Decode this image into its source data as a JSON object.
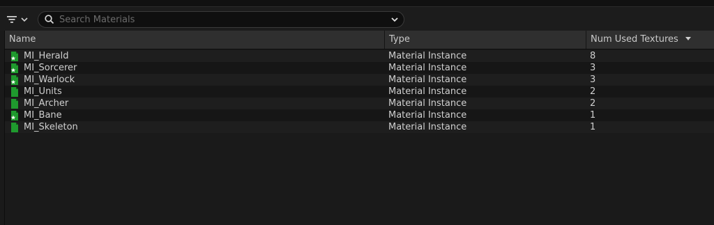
{
  "toolbar": {
    "filter_icon": "filter-icon",
    "search": {
      "placeholder": "Search Materials",
      "value": ""
    }
  },
  "table": {
    "columns": [
      {
        "label": "Name"
      },
      {
        "label": "Type"
      },
      {
        "label": "Num Used Textures",
        "sorted": "descending"
      }
    ],
    "rows": [
      {
        "name": "MI_Herald",
        "type": "Material Instance",
        "num_used_textures": "8",
        "icon": "material-instance-star-icon"
      },
      {
        "name": "MI_Sorcerer",
        "type": "Material Instance",
        "num_used_textures": "3",
        "icon": "material-instance-star-icon"
      },
      {
        "name": "MI_Warlock",
        "type": "Material Instance",
        "num_used_textures": "3",
        "icon": "material-instance-star-icon"
      },
      {
        "name": "MI_Units",
        "type": "Material Instance",
        "num_used_textures": "2",
        "icon": "material-instance-icon"
      },
      {
        "name": "MI_Archer",
        "type": "Material Instance",
        "num_used_textures": "2",
        "icon": "material-instance-icon"
      },
      {
        "name": "MI_Bane",
        "type": "Material Instance",
        "num_used_textures": "1",
        "icon": "material-instance-star-icon"
      },
      {
        "name": "MI_Skeleton",
        "type": "Material Instance",
        "num_used_textures": "1",
        "icon": "material-instance-icon"
      }
    ]
  },
  "colors": {
    "background": "#1a1a1a",
    "header_background": "#2f2f2f",
    "asset_icon_green": "#1f9a2e"
  }
}
